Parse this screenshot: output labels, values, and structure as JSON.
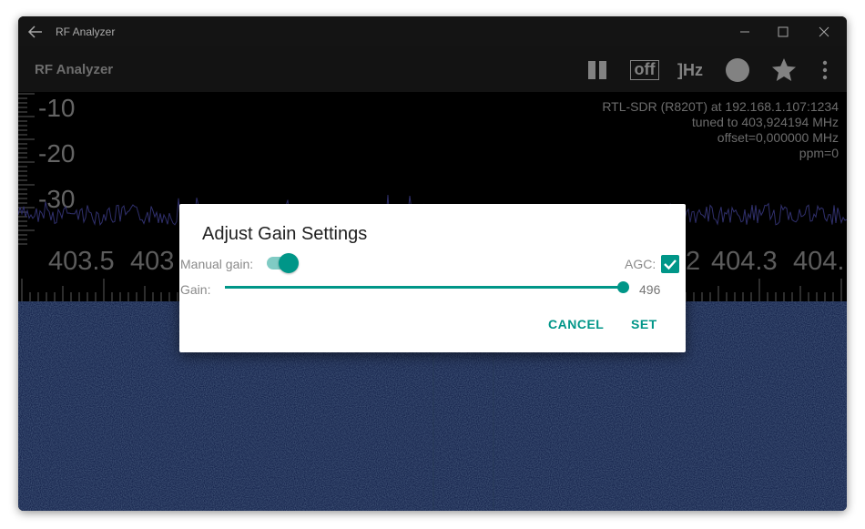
{
  "window": {
    "title": "RF Analyzer",
    "back_icon": "arrow-left-icon",
    "controls": [
      "minimize-icon",
      "maximize-icon",
      "close-icon"
    ]
  },
  "appbar": {
    "title": "RF Analyzer",
    "actions": [
      {
        "name": "pause-icon"
      },
      {
        "name": "demodulation-off-icon",
        "label": "off"
      },
      {
        "name": "frequency-set-icon",
        "label": "]Hz"
      },
      {
        "name": "record-icon"
      },
      {
        "name": "star-icon"
      },
      {
        "name": "overflow-menu-icon"
      }
    ]
  },
  "fft": {
    "db_labels": [
      "-10",
      "-20",
      "-30"
    ],
    "info_lines": [
      "RTL-SDR (R820T) at 192.168.1.107:1234",
      "tuned to 403,924194 MHz",
      "offset=0,000000 MHz",
      "ppm=0"
    ],
    "freq_labels": [
      "403.5",
      "403",
      "2",
      "404.3",
      "404."
    ]
  },
  "dialog": {
    "title": "Adjust Gain Settings",
    "manual_gain_label": "Manual gain:",
    "manual_gain_on": true,
    "agc_label": "AGC:",
    "agc_checked": true,
    "gain_label": "Gain:",
    "gain_value": "496",
    "gain_fraction": 1.0,
    "cancel_label": "CANCEL",
    "set_label": "SET"
  },
  "colors": {
    "accent": "#009688",
    "accent_light": "#80cbc4",
    "waterfall": "#243a78",
    "spectrum_line": "#4b4ba8"
  }
}
